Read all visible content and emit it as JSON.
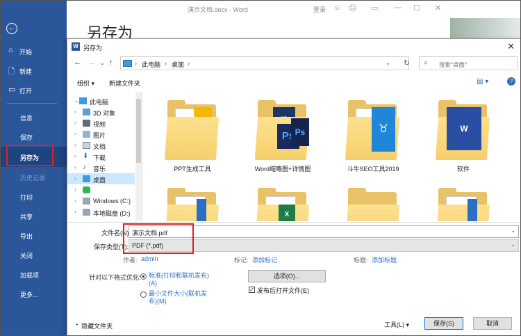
{
  "word": {
    "title": "演示文档.docx  -  Word",
    "login": "登录",
    "heading": "另存为"
  },
  "sidebar": {
    "items": [
      {
        "label": "开始",
        "icon": "home-icon"
      },
      {
        "label": "新建",
        "icon": "new-document-icon"
      },
      {
        "label": "打开",
        "icon": "folder-open-icon"
      },
      {
        "label": "信息"
      },
      {
        "label": "保存"
      },
      {
        "label": "另存为"
      },
      {
        "label": "历史记录"
      },
      {
        "label": "打印"
      },
      {
        "label": "共享"
      },
      {
        "label": "导出"
      },
      {
        "label": "关闭"
      },
      {
        "label": "加载项"
      },
      {
        "label": "更多..."
      }
    ]
  },
  "dialog": {
    "title": "另存为",
    "breadcrumb": [
      "此电脑",
      "桌面"
    ],
    "search_placeholder": "搜索\"桌面\"",
    "toolbar": {
      "organize": "组织 ▾",
      "new_folder": "新建文件夹"
    },
    "tree": [
      {
        "label": "此电脑",
        "expanded": true
      },
      {
        "label": "3D 对象"
      },
      {
        "label": "视频"
      },
      {
        "label": "图片"
      },
      {
        "label": "文档"
      },
      {
        "label": "下载"
      },
      {
        "label": "音乐"
      },
      {
        "label": "桌面",
        "selected": true
      },
      {
        "label": ""
      },
      {
        "label": "Windows (C:)"
      },
      {
        "label": "本地磁盘 (D:)"
      }
    ],
    "files": [
      {
        "name": "PPT生成工具"
      },
      {
        "name": "Word缩略图+详情图"
      },
      {
        "name": "斗牛SEO工具2019"
      },
      {
        "name": "软件"
      },
      {
        "name": ""
      },
      {
        "name": ""
      },
      {
        "name": ""
      },
      {
        "name": ""
      }
    ],
    "form": {
      "filename_label": "文件名(N):",
      "filename_value": "演示文档.pdf",
      "filetype_label": "保存类型(T):",
      "filetype_value": "PDF (*.pdf)",
      "author_label": "作者:",
      "author_value": "admin",
      "tags_label": "标记:",
      "tags_value": "添加标记",
      "title_label": "标题:",
      "title_value": "添加标题",
      "optimize_label": "针对以下格式优化:",
      "radio_standard": "标准(打印和联机发布)",
      "radio_standard_key": "(A)",
      "radio_min": "最小文件大小(联机发",
      "radio_min_key": "布)(M)",
      "options_button": "选项(O)...",
      "open_after": "发布后打开文件(E)"
    },
    "footer": {
      "hide_folders": "隐藏文件夹",
      "tools": "工具(L)",
      "save": "保存(S)",
      "cancel": "取消"
    }
  }
}
